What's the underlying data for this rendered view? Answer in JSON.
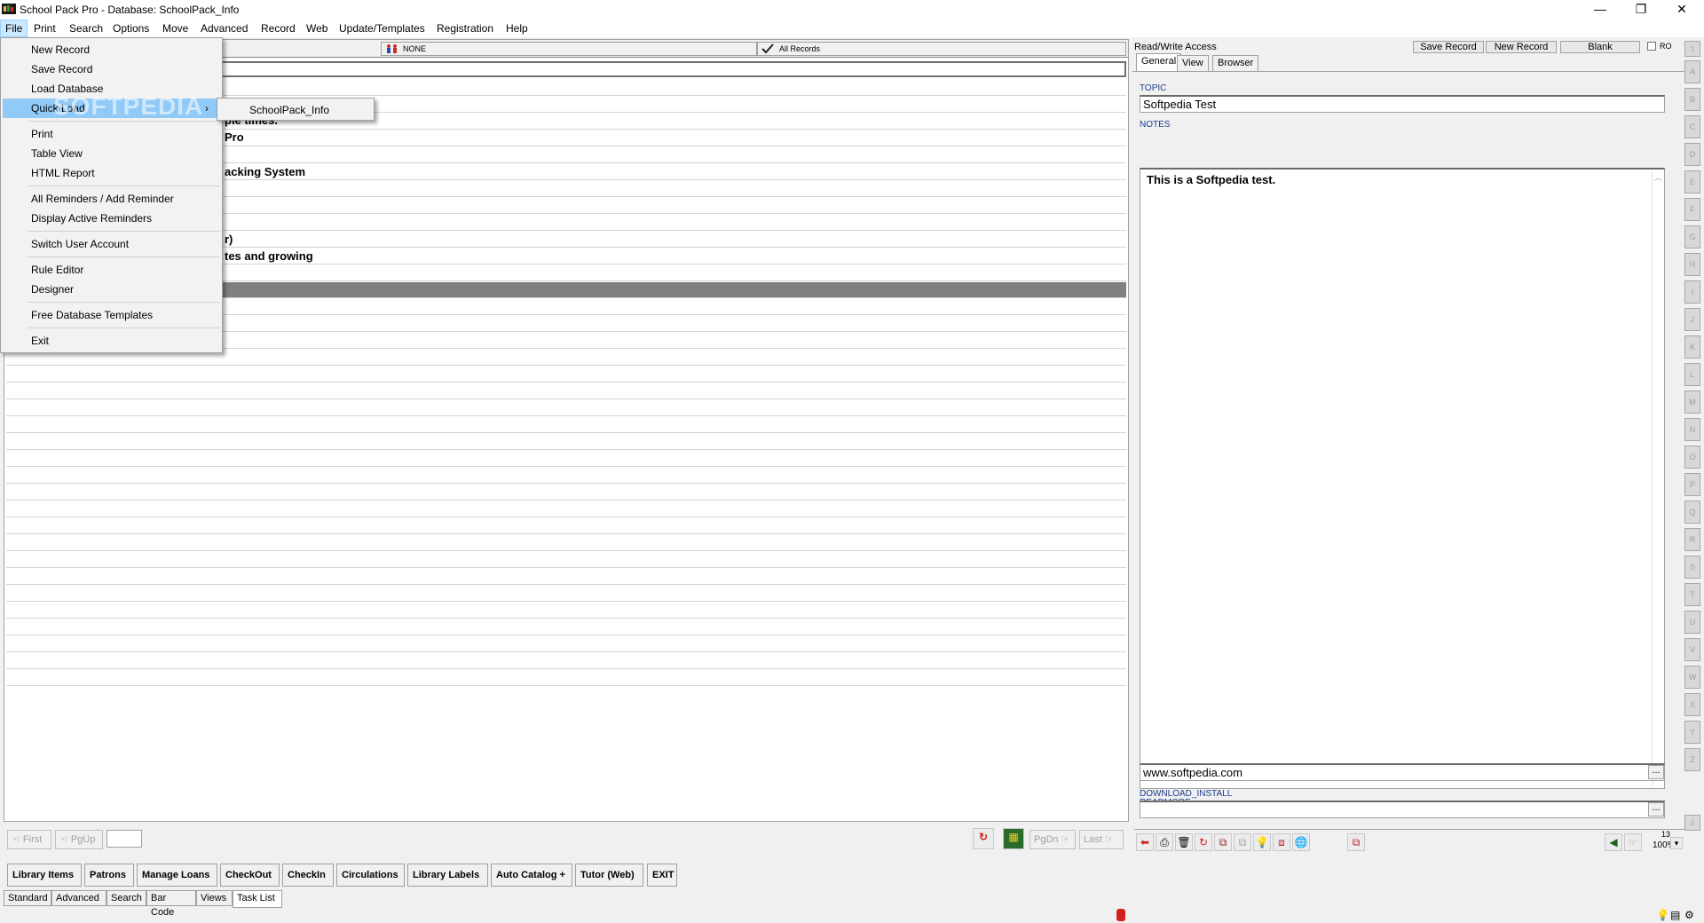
{
  "window": {
    "title": "School Pack Pro - Database: SchoolPack_Info",
    "minimize": "—",
    "maximize": "❐",
    "close": "✕"
  },
  "menubar": [
    "File",
    "Print",
    "Search",
    "Options",
    "Move",
    "Advanced",
    "Record",
    "Web",
    "Update/Templates",
    "Registration",
    "Help"
  ],
  "file_menu": {
    "items": [
      "New Record",
      "Save Record",
      "Load Database",
      "Quick Load",
      "Print",
      "Table View",
      "HTML Report",
      "All Reminders / Add Reminder",
      "Display Active Reminders",
      "Switch User Account",
      "Rule Editor",
      "Designer",
      "Free Database Templates",
      "Exit"
    ],
    "submenu_arrow": "›",
    "quick_load_submenu": [
      "SchoolPack_Info"
    ]
  },
  "watermark": "SOFTPEDIA",
  "list": {
    "header_filter": "NONE",
    "header_records": "All Records",
    "rows": [
      "ple times.",
      "Pro",
      "acking System",
      "r)",
      "tes and growing"
    ]
  },
  "list_nav": {
    "first": "First",
    "pgup": "PgUp",
    "pgdn": "PgDn",
    "last": "Last"
  },
  "detail": {
    "access": "Read/Write Access",
    "save_record": "Save Record",
    "new_record": "New Record",
    "blank": "Blank",
    "ro": "RO",
    "tabs": [
      "General",
      "View",
      "Browser"
    ],
    "topic_label": "TOPIC",
    "topic_value": "Softpedia Test",
    "notes_label": "NOTES",
    "notes_value": "This is a Softpedia test.",
    "readmore_label": "READMORE",
    "readmore_value": "www.softpedia.com",
    "download_label": "DOWNLOAD_INSTALL",
    "download_value": "",
    "ellipsis": "...",
    "zoom_top": "13",
    "zoom": "100%"
  },
  "alphabet": [
    "A",
    "B",
    "C",
    "D",
    "E",
    "F",
    "G",
    "H",
    "I",
    "J",
    "K",
    "L",
    "M",
    "N",
    "O",
    "P",
    "Q",
    "R",
    "S",
    "T",
    "U",
    "V",
    "W",
    "X",
    "Y",
    "Z"
  ],
  "bottom_buttons": [
    "Library Items",
    "Patrons",
    "Manage Loans",
    "CheckOut",
    "CheckIn",
    "Circulations",
    "Library Labels",
    "Auto Catalog +",
    "Tutor (Web)",
    "EXIT"
  ],
  "bottom_tabs": [
    "Standard",
    "Advanced",
    "Search",
    "Bar Code",
    "Views",
    "Task List"
  ],
  "colors": {
    "menu_highlight": "#91c9f7",
    "selected_row": "#808080",
    "field_label": "#1a3a8c"
  }
}
